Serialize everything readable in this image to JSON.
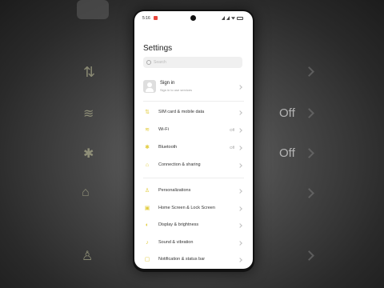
{
  "background": {
    "right_values": [
      "Off",
      "Off"
    ]
  },
  "status_bar": {
    "time": "5:16"
  },
  "settings": {
    "title": "Settings",
    "search_placeholder": "Search",
    "account": {
      "label": "Sign in",
      "sublabel": "Sign in to use services"
    },
    "groups": [
      [
        {
          "label": "SIM card & mobile data",
          "value": "",
          "icon": "sim-icon"
        },
        {
          "label": "Wi-Fi",
          "value": "Off",
          "icon": "wifi-icon"
        },
        {
          "label": "Bluetooth",
          "value": "Off",
          "icon": "bluetooth-icon"
        },
        {
          "label": "Connection & sharing",
          "value": "",
          "icon": "connection-icon"
        }
      ],
      [
        {
          "label": "Personalizations",
          "value": "",
          "icon": "personalization-icon"
        },
        {
          "label": "Home Screen & Lock Screen",
          "value": "",
          "icon": "home-screen-icon"
        },
        {
          "label": "Display & brightness",
          "value": "",
          "icon": "display-icon"
        },
        {
          "label": "Sound & vibration",
          "value": "",
          "icon": "sound-icon"
        },
        {
          "label": "Notification & status bar",
          "value": "",
          "icon": "notification-icon"
        }
      ]
    ]
  },
  "colors": {
    "icon_accent": "#e2cc3e",
    "screen_bg": "#ffffff",
    "frame": "#111111"
  }
}
